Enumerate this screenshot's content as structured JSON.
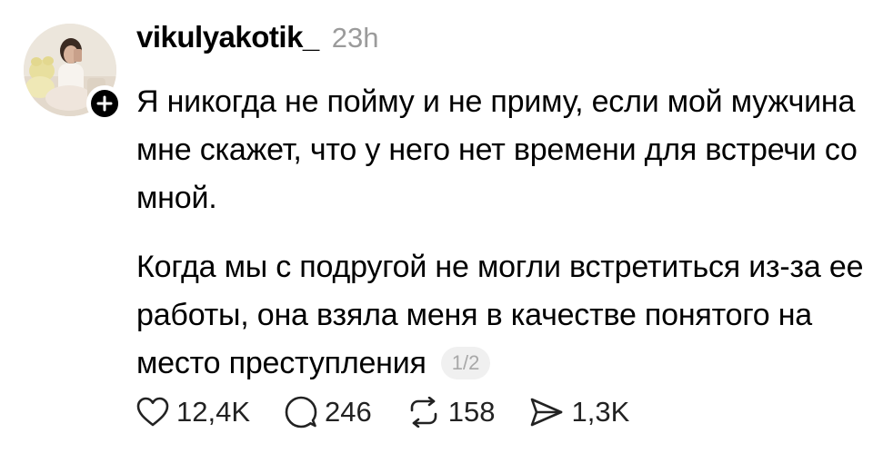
{
  "post": {
    "username": "vikulyakotik_",
    "timestamp": "23h",
    "paragraphs": [
      "Я никогда не пойму и не приму, если мой мужчина мне скажет, что у него нет времени для встречи со мной.",
      "Когда мы с подругой не могли встретиться из-за ее работы, она взяла меня в качестве понятого на место преступления"
    ],
    "page_indicator": "1/2",
    "actions": {
      "like_count": "12,4K",
      "reply_count": "246",
      "repost_count": "158",
      "share_count": "1,3K"
    },
    "icons": {
      "like": "heart-icon",
      "reply": "speech-bubble-icon",
      "repost": "repost-icon",
      "share": "send-icon",
      "follow": "plus-icon"
    }
  }
}
